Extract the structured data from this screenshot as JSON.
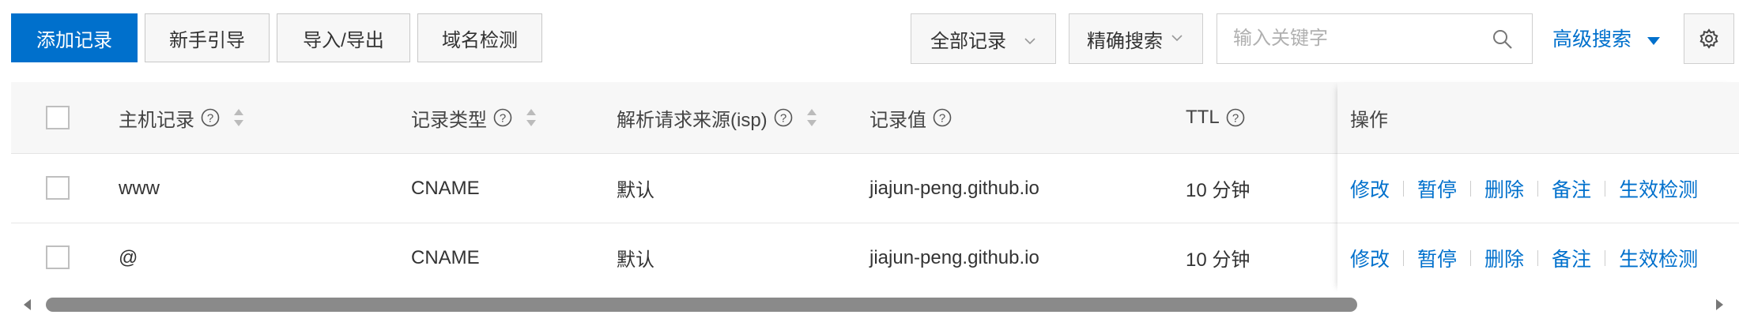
{
  "toolbar": {
    "add_record": "添加记录",
    "guide": "新手引导",
    "import_export": "导入/导出",
    "domain_check": "域名检测",
    "record_filter": "全部记录",
    "search_mode": "精确搜索",
    "search_placeholder": "输入关键字",
    "search_value": "",
    "advanced_search": "高级搜索"
  },
  "table": {
    "columns": {
      "host": "主机记录",
      "type": "记录类型",
      "isp": "解析请求来源(isp)",
      "value": "记录值",
      "ttl": "TTL",
      "actions": "操作"
    },
    "rows": [
      {
        "host": "www",
        "type": "CNAME",
        "isp": "默认",
        "value": "jiajun-peng.github.io",
        "ttl": "10 分钟"
      },
      {
        "host": "@",
        "type": "CNAME",
        "isp": "默认",
        "value": "jiajun-peng.github.io",
        "ttl": "10 分钟"
      }
    ],
    "actions": [
      "修改",
      "暂停",
      "删除",
      "备注",
      "生效检测"
    ]
  },
  "scrollbar": {
    "horizontal_position_fraction": 0.0,
    "visible_fraction": 0.79
  },
  "colors": {
    "accent": "#0070cc",
    "header_bg": "#f7f7f7",
    "button_bg": "#f7f7f7"
  },
  "icons": [
    "chevron-down-icon",
    "search-icon",
    "caret-down-icon",
    "gear-icon",
    "help-icon",
    "sort-icon",
    "arrow-left-icon",
    "arrow-right-icon"
  ]
}
